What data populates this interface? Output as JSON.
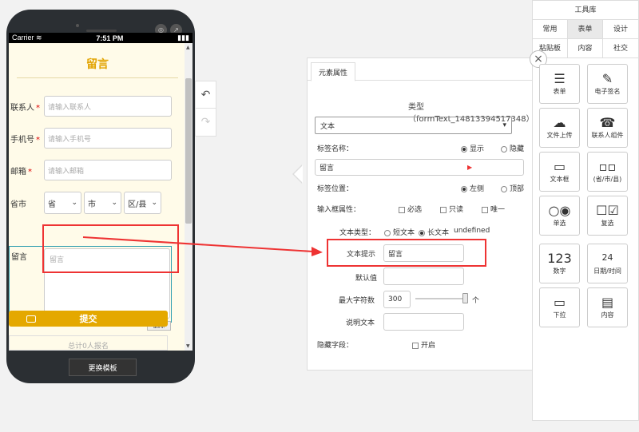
{
  "phone": {
    "carrier": "Carrier",
    "time": "7:51 PM",
    "battery": "▮",
    "form_title": "留言",
    "fields": [
      {
        "label": "联系人",
        "required": "*",
        "placeholder": "请输入联系人"
      },
      {
        "label": "手机号",
        "required": "*",
        "placeholder": "请输入手机号"
      },
      {
        "label": "邮箱",
        "required": "*",
        "placeholder": "请输入邮箱"
      }
    ],
    "region": {
      "label": "省市",
      "province": "省",
      "city": "市",
      "district": "区/县"
    },
    "message": {
      "label": "留言",
      "placeholder": "留言"
    },
    "delete_label": "删除",
    "submit_label": "提交",
    "count_text": "总计0人报名",
    "change_template": "更换模板"
  },
  "panel": {
    "tab": "元素属性",
    "type_text": "类型（formText_14813394517348）",
    "type_select": "文本",
    "label_name": "标签名称：",
    "show": "显示",
    "hide": "隐藏",
    "label_value": "留言",
    "label_pos": "标签位置：",
    "left": "左侧",
    "top": "顶部",
    "input_attr": "输入框属性：",
    "required": "必选",
    "readonly": "只读",
    "unique": "唯一",
    "text_type": "文本类型：",
    "short_text": "短文本",
    "long_text": "长文本",
    "undefined": "undefined",
    "hint_label": "文本提示",
    "hint_value": "留言",
    "default_label": "默认值",
    "max_chars_label": "最大字符数",
    "max_chars_value": "300",
    "unit": "个",
    "desc_label": "说明文本",
    "hidden_label": "隐藏字段：",
    "open": "开启"
  },
  "toolbox": {
    "title": "工具库",
    "tabs": [
      "常用",
      "表单",
      "设计",
      "粘贴板",
      "内容",
      "社交"
    ],
    "active_tab": "表单",
    "tools": [
      {
        "icon": "form-icon",
        "label": "表单"
      },
      {
        "icon": "signature-icon",
        "label": "电子签名"
      },
      {
        "icon": "upload-icon",
        "label": "文件上传"
      },
      {
        "icon": "contact-icon",
        "label": "联系人组件"
      },
      {
        "icon": "textbox-icon",
        "label": "文本框"
      },
      {
        "icon": "region-icon",
        "label": "(省/市/县)"
      },
      {
        "icon": "radio-icon",
        "label": "单选"
      },
      {
        "icon": "checkbox-icon",
        "label": "复选"
      },
      {
        "icon": "number-icon",
        "label": "数字",
        "glyph": "123"
      },
      {
        "icon": "calendar-icon",
        "label": "日期/时间",
        "glyph": "24"
      },
      {
        "icon": "dropdown-icon",
        "label": "下拉"
      },
      {
        "icon": "content-icon",
        "label": "内容"
      }
    ]
  },
  "colors": {
    "accent": "#e4a800",
    "annotation": "#ee3333",
    "selection": "#2e9eb0"
  }
}
